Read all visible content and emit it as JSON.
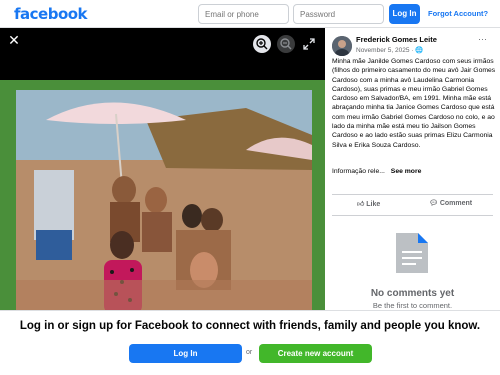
{
  "header": {
    "logo": "facebook",
    "email_placeholder": "Email or phone",
    "password_placeholder": "Password",
    "login_label": "Log In",
    "forgot_label": "Forgot Account?"
  },
  "viewer": {
    "close_icon": "close-icon",
    "zoom_in_icon": "zoom-in-icon",
    "zoom_out_icon": "zoom-out-icon",
    "expand_icon": "expand-icon"
  },
  "post": {
    "author": "Frederick Gomes Leite",
    "date": "November 5, 2025",
    "privacy_icon": "globe-icon",
    "caption": "Minha mãe Janilde Gomes Cardoso com seus irmãos (filhos do primeiro casamento do meu avô Jair Gomes Cardoso com a minha avô Laudelina Carmonia Cardoso), suas primas e meu irmão Gabriel Gomes Cardoso em Salvador/BA, em 1991. Minha mãe está abraçando minha tia Janice Gomes Cardoso que está com meu irmão Gabriel Gomes Cardoso no colo, e ao lado da minha mãe está meu tio Jailson Gomes Cardoso e ao lado estão suas primas Elizu Carmonia Silva e Erika Souza Cardoso.",
    "info_text": "Informação rele...",
    "see_more": "See more",
    "like_label": "Like",
    "comment_label": "Comment",
    "no_comments": "No comments yet",
    "first_comment": "Be the first to comment."
  },
  "footer": {
    "prompt": "Log in or sign up for Facebook to connect with friends, family and people you know.",
    "login_label": "Log In",
    "or_label": "or",
    "create_label": "Create new account"
  },
  "colors": {
    "brand_blue": "#1877f2",
    "create_green": "#42b72a",
    "viewer_bg": "#000000"
  }
}
